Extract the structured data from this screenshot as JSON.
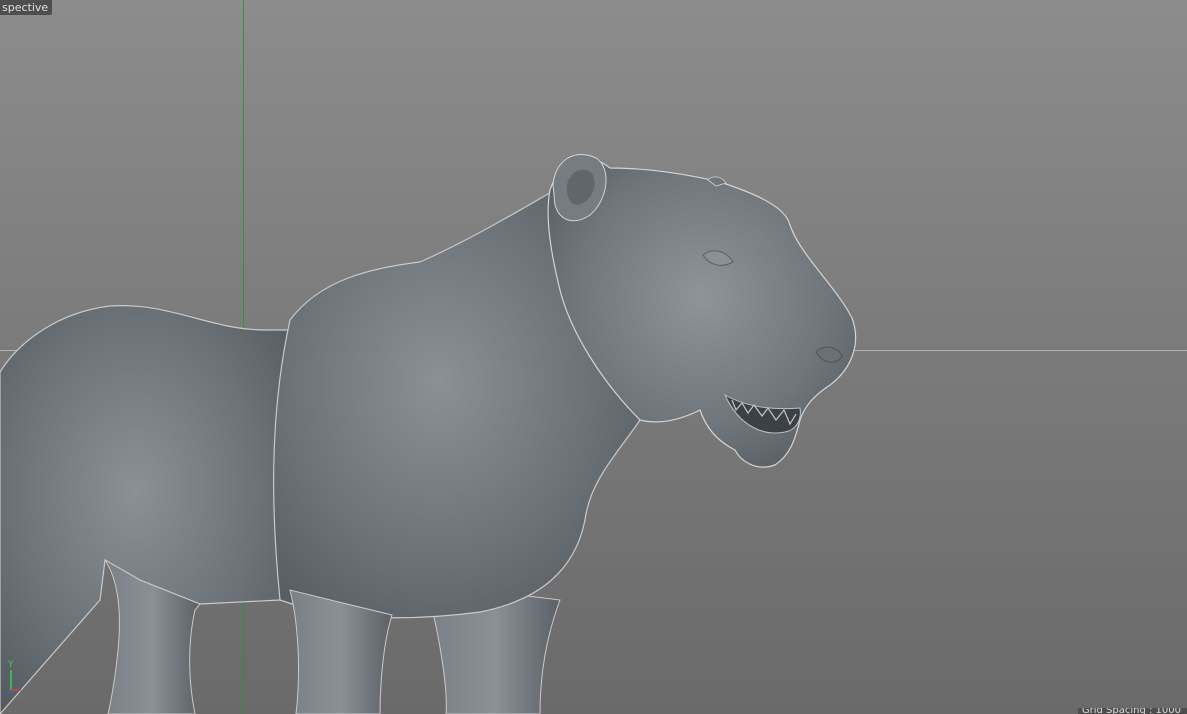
{
  "viewport": {
    "label": "spective",
    "status_text": "Grid Spacing : 1000"
  },
  "gizmo": {
    "y_axis_label": "Y"
  },
  "colors": {
    "background_top": "#8c8c8c",
    "background_bottom": "#6a6a6a",
    "y_axis_line": "#1f9a2c",
    "x_axis_line": "#b9b9b9",
    "model_shade": "#6e747a"
  },
  "scene": {
    "model": "panther-sculpt"
  }
}
